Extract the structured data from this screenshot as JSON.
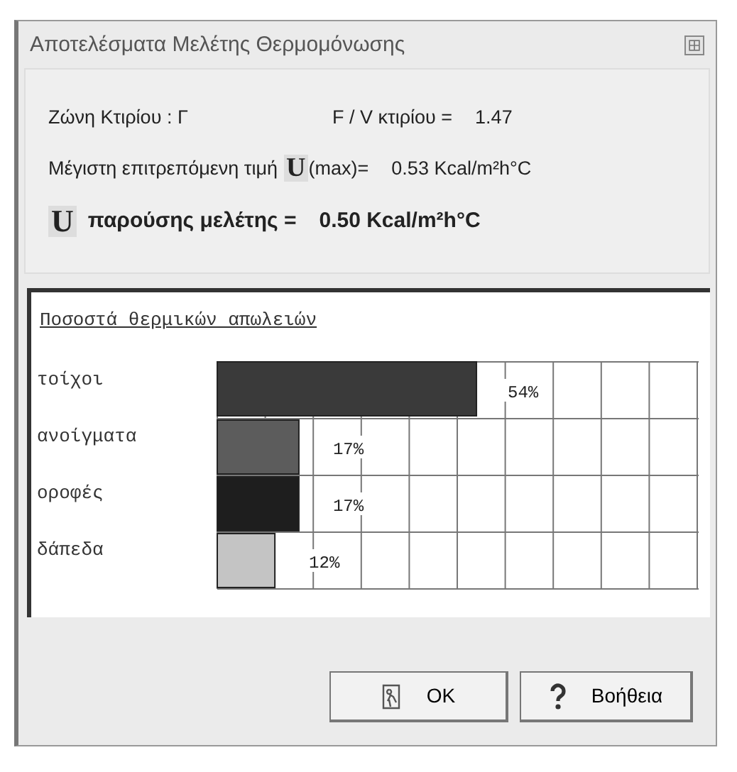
{
  "window": {
    "title": "Αποτελέσματα Μελέτης Θερμομόνωσης"
  },
  "info": {
    "zone": "Ζώνη Κτιρίου : Γ",
    "fv_label": "F / V κτιρίου =",
    "fv_value": "1.47",
    "max_label": "Μέγιστη επιτρεπόμενη τιμή",
    "max_symbol": "U",
    "max_suffix": "(max)=",
    "max_value": "0.53 Kcal/m²h°C",
    "current_symbol": "U",
    "current_label": "παρούσης μελέτης =",
    "current_value": "0.50 Kcal/m²h°C"
  },
  "chart": {
    "chart_data": {
      "type": "bar",
      "orientation": "horizontal",
      "title": "Ποσοστά θερμικών απωλειών",
      "categories": [
        "τοίχοι",
        "ανοίγματα",
        "οροφές",
        "δάπεδα"
      ],
      "values": [
        54,
        17,
        17,
        12
      ],
      "colors": [
        "#3a3a3a",
        "#5c5c5c",
        "#1e1e1e",
        "#c4c4c4"
      ],
      "value_labels": [
        "54%",
        "17%",
        "17%",
        "12%"
      ],
      "xlim": [
        0,
        100
      ]
    }
  },
  "buttons": [
    {
      "kind": "ok",
      "label": "OK"
    },
    {
      "kind": "help",
      "label": "Βοήθεια"
    }
  ]
}
